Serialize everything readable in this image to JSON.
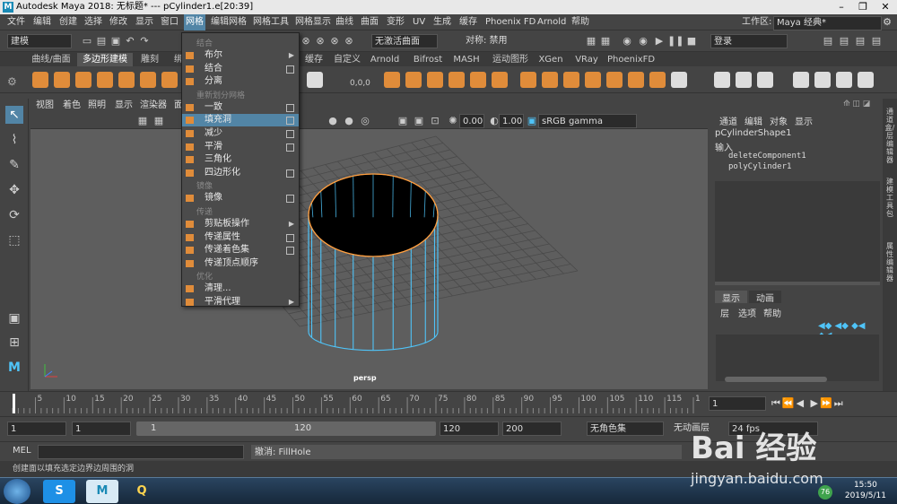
{
  "title_bar": {
    "app_logo": "M",
    "title": "Autodesk Maya 2018: 无标题*   ---   pCylinder1.e[20:39]",
    "min": "–",
    "max": "❐",
    "close": "✕"
  },
  "menu_bar": {
    "items": [
      "文件",
      "编辑",
      "创建",
      "选择",
      "修改",
      "显示",
      "窗口",
      "网格",
      "编辑网格",
      "网格工具",
      "网格显示",
      "曲线",
      "曲面",
      "变形",
      "UV",
      "生成",
      "缓存",
      "Phoenix FD",
      "Arnold",
      "帮助"
    ],
    "active": "网格",
    "workspace_label": "工作区:",
    "workspace_value": "Maya 经典*"
  },
  "status_line": {
    "mode": "建模",
    "selection_field": "无激活曲面",
    "symmetry": "对称: 禁用",
    "login": "登录"
  },
  "shelf": {
    "tabs": [
      "曲线/曲面",
      "多边形建模",
      "雕刻",
      "绑",
      "",
      "缓存",
      "自定义",
      "Arnold",
      "Bifrost",
      "MASH",
      "运动图形",
      "XGen",
      "VRay",
      "PhoenixFD"
    ],
    "selected": "多边形建模",
    "counter": "0,0,0"
  },
  "dropdown": {
    "sections": [
      {
        "header": "结合",
        "items": [
          {
            "label": "布尔",
            "type": "submenu"
          },
          {
            "label": "结合",
            "type": "option"
          },
          {
            "label": "分离",
            "type": "plain"
          }
        ]
      },
      {
        "header": "重新划分网格",
        "items": [
          {
            "label": "一致",
            "type": "option"
          },
          {
            "label": "填充洞",
            "type": "highlight"
          },
          {
            "label": "减少",
            "type": "option"
          },
          {
            "label": "平滑",
            "type": "option"
          },
          {
            "label": "三角化",
            "type": "plain"
          },
          {
            "label": "四边形化",
            "type": "option"
          }
        ]
      },
      {
        "header": "镜像",
        "items": [
          {
            "label": "镜像",
            "type": "option"
          }
        ]
      },
      {
        "header": "传递",
        "items": [
          {
            "label": "剪贴板操作",
            "type": "submenu"
          },
          {
            "label": "传递属性",
            "type": "option"
          },
          {
            "label": "传递着色集",
            "type": "option"
          },
          {
            "label": "传递顶点顺序",
            "type": "plain"
          }
        ]
      },
      {
        "header": "优化",
        "items": [
          {
            "label": "清理...",
            "type": "plain"
          },
          {
            "label": "平滑代理",
            "type": "submenu"
          }
        ]
      }
    ]
  },
  "viewport": {
    "menu": [
      "视图",
      "着色",
      "照明",
      "显示",
      "渲染器",
      "面板"
    ],
    "field_a": "0.00",
    "field_b": "1.00",
    "color_space": "sRGB gamma",
    "camera_label": "persp"
  },
  "right_panel": {
    "tabs": [
      "通道",
      "编辑",
      "对象",
      "显示"
    ],
    "object_name": "pCylinderShape1",
    "input_label": "输入",
    "inputs": [
      "deleteComponent1",
      "polyCylinder1"
    ],
    "layer_tabs": [
      "显示",
      "动画"
    ],
    "layer_menu": [
      "层",
      "选项",
      "帮助"
    ],
    "vertical_tabs": [
      "通道盒/层编辑器",
      "建模工具包",
      "属性编辑器"
    ]
  },
  "timeline": {
    "ticks": [
      "5",
      "10",
      "15",
      "20",
      "25",
      "30",
      "35",
      "40",
      "45",
      "50",
      "55",
      "60",
      "65",
      "70",
      "75",
      "80",
      "85",
      "90",
      "95",
      "100",
      "105",
      "110",
      "115",
      "1"
    ],
    "current_frame": "1"
  },
  "range_slider": {
    "start_a": "1",
    "start_b": "1",
    "slider_start": "1",
    "slider_end": "120",
    "end_a": "120",
    "end_b": "200",
    "char_set": "无角色集",
    "anim_layer": "无动画层",
    "fps": "24 fps"
  },
  "command_line": {
    "label": "MEL",
    "result": "撤消: FillHole"
  },
  "help_line": "创建面以填充选定边界边周围的洞",
  "taskbar": {
    "apps": [
      "S",
      "M",
      "Q"
    ],
    "time": "15:50",
    "date": "2019/5/11",
    "badge": "76"
  },
  "watermark": {
    "brand": "Bai 经验",
    "url": "jingyan.baidu.com"
  },
  "colors": {
    "accent": "#5285a6",
    "orange": "#e08c3a",
    "cylinder": "#4fc3f7"
  }
}
